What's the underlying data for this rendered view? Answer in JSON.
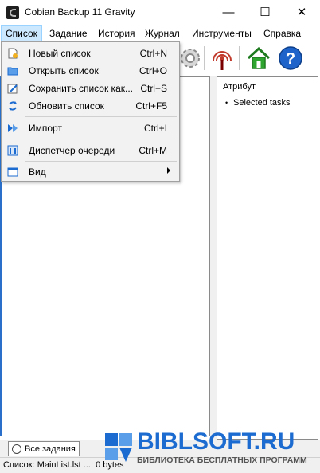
{
  "window": {
    "title": "Cobian Backup 11 Gravity",
    "minimize": "—",
    "maximize": "☐",
    "close": "✕"
  },
  "menubar": {
    "items": [
      {
        "label": "Список",
        "active": true
      },
      {
        "label": "Задание"
      },
      {
        "label": "История"
      },
      {
        "label": "Журнал"
      },
      {
        "label": "Инструменты"
      },
      {
        "label": "Справка"
      }
    ]
  },
  "dropdown": {
    "items": [
      {
        "label": "Новый список",
        "shortcut": "Ctrl+N",
        "icon": "new-list-icon"
      },
      {
        "label": "Открыть список",
        "shortcut": "Ctrl+O",
        "icon": "open-folder-icon"
      },
      {
        "label": "Сохранить список как...",
        "shortcut": "Ctrl+S",
        "icon": "save-as-icon"
      },
      {
        "label": "Обновить список",
        "shortcut": "Ctrl+F5",
        "icon": "refresh-icon"
      },
      {
        "label": "Импорт",
        "shortcut": "Ctrl+I",
        "icon": "import-icon"
      },
      {
        "label": "Диспетчер очереди",
        "shortcut": "Ctrl+M",
        "icon": "queue-manager-icon"
      },
      {
        "label": "Вид",
        "shortcut": "",
        "icon": "view-icon",
        "submenu": true
      }
    ]
  },
  "toolbar": {
    "icons": [
      "settings-gear-icon",
      "antenna-icon",
      "home-icon",
      "help-icon"
    ]
  },
  "right_pane": {
    "header": "Атрибут",
    "items": [
      "Selected tasks"
    ]
  },
  "tabs": [
    {
      "label": "Все задания"
    }
  ],
  "status": {
    "text": "Список: MainList.lst ...: 0 bytes"
  },
  "watermark": {
    "title": "BIBLSOFT.RU",
    "subtitle": "БИБЛИОТЕКА БЕСПЛАТНЫХ ПРОГРАММ"
  },
  "colors": {
    "menu_highlight": "#cce8ff",
    "watermark_blue": "#1c6bd0",
    "selection_border": "#2a6fc9"
  }
}
